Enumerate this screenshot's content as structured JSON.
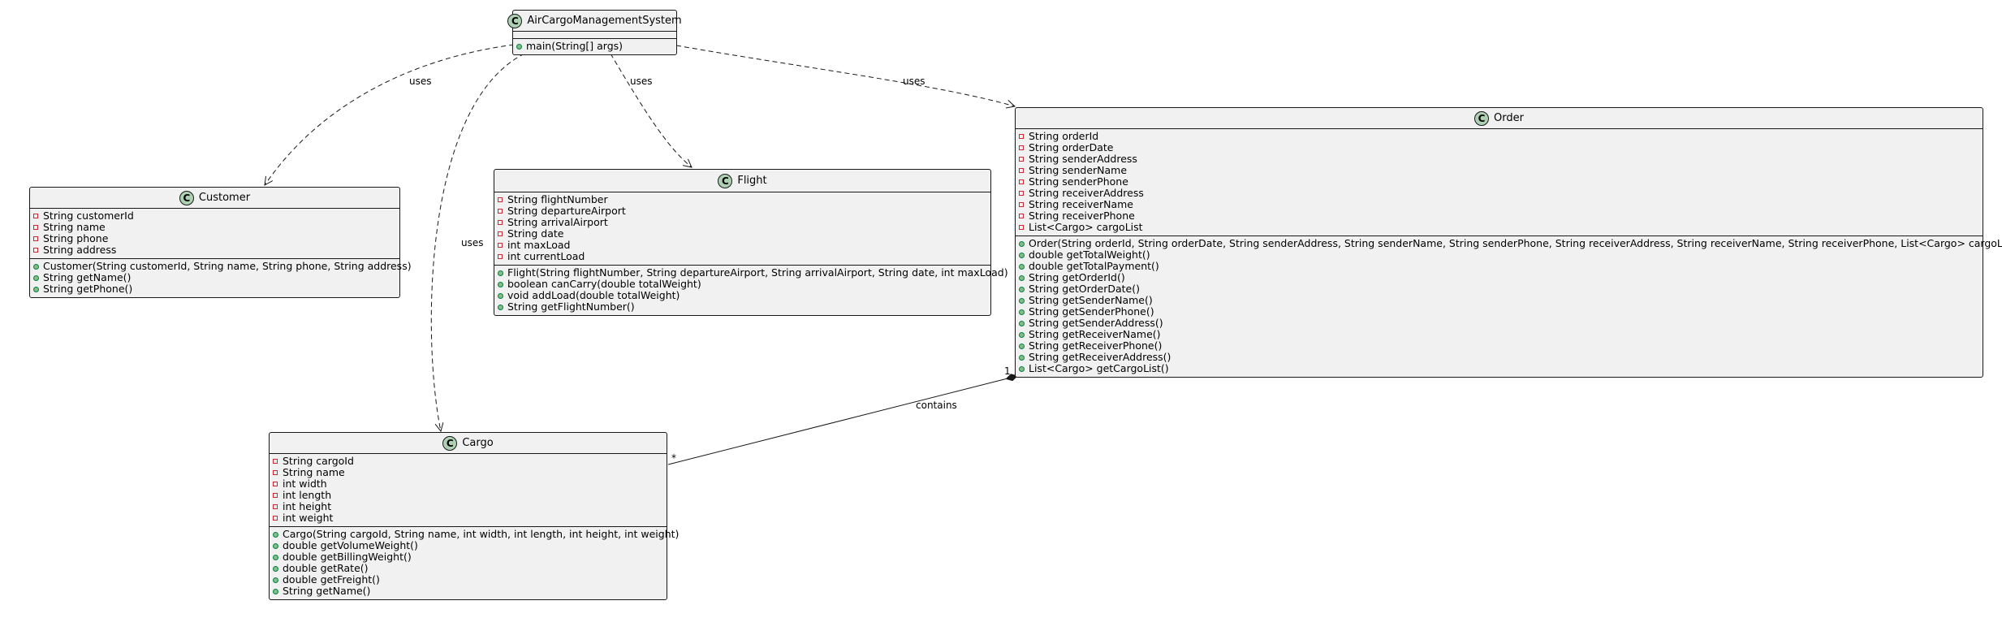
{
  "diagram": {
    "classes": [
      {
        "id": "acms",
        "badge": "C",
        "name": "AirCargoManagementSystem",
        "attributes": [],
        "methods": [
          {
            "vis": "public",
            "text": "main(String[] args)"
          }
        ]
      },
      {
        "id": "customer",
        "badge": "C",
        "name": "Customer",
        "attributes": [
          {
            "vis": "private",
            "text": "String customerId"
          },
          {
            "vis": "private",
            "text": "String name"
          },
          {
            "vis": "private",
            "text": "String phone"
          },
          {
            "vis": "private",
            "text": "String address"
          }
        ],
        "methods": [
          {
            "vis": "public",
            "text": "Customer(String customerId, String name, String phone, String address)"
          },
          {
            "vis": "public",
            "text": "String getName()"
          },
          {
            "vis": "public",
            "text": "String getPhone()"
          }
        ]
      },
      {
        "id": "flight",
        "badge": "C",
        "name": "Flight",
        "attributes": [
          {
            "vis": "private",
            "text": "String flightNumber"
          },
          {
            "vis": "private",
            "text": "String departureAirport"
          },
          {
            "vis": "private",
            "text": "String arrivalAirport"
          },
          {
            "vis": "private",
            "text": "String date"
          },
          {
            "vis": "private",
            "text": "int maxLoad"
          },
          {
            "vis": "private",
            "text": "int currentLoad"
          }
        ],
        "methods": [
          {
            "vis": "public",
            "text": "Flight(String flightNumber, String departureAirport, String arrivalAirport, String date, int maxLoad)"
          },
          {
            "vis": "public",
            "text": "boolean canCarry(double totalWeight)"
          },
          {
            "vis": "public",
            "text": "void addLoad(double totalWeight)"
          },
          {
            "vis": "public",
            "text": "String getFlightNumber()"
          }
        ]
      },
      {
        "id": "order",
        "badge": "C",
        "name": "Order",
        "attributes": [
          {
            "vis": "private",
            "text": "String orderId"
          },
          {
            "vis": "private",
            "text": "String orderDate"
          },
          {
            "vis": "private",
            "text": "String senderAddress"
          },
          {
            "vis": "private",
            "text": "String senderName"
          },
          {
            "vis": "private",
            "text": "String senderPhone"
          },
          {
            "vis": "private",
            "text": "String receiverAddress"
          },
          {
            "vis": "private",
            "text": "String receiverName"
          },
          {
            "vis": "private",
            "text": "String receiverPhone"
          },
          {
            "vis": "private",
            "text": "List<Cargo> cargoList"
          }
        ],
        "methods": [
          {
            "vis": "public",
            "text": "Order(String orderId, String orderDate, String senderAddress, String senderName, String senderPhone, String receiverAddress, String receiverName, String receiverPhone, List<Cargo> cargoList)"
          },
          {
            "vis": "public",
            "text": "double getTotalWeight()"
          },
          {
            "vis": "public",
            "text": "double getTotalPayment()"
          },
          {
            "vis": "public",
            "text": "String getOrderId()"
          },
          {
            "vis": "public",
            "text": "String getOrderDate()"
          },
          {
            "vis": "public",
            "text": "String getSenderName()"
          },
          {
            "vis": "public",
            "text": "String getSenderPhone()"
          },
          {
            "vis": "public",
            "text": "String getSenderAddress()"
          },
          {
            "vis": "public",
            "text": "String getReceiverName()"
          },
          {
            "vis": "public",
            "text": "String getReceiverPhone()"
          },
          {
            "vis": "public",
            "text": "String getReceiverAddress()"
          },
          {
            "vis": "public",
            "text": "List<Cargo> getCargoList()"
          }
        ]
      },
      {
        "id": "cargo",
        "badge": "C",
        "name": "Cargo",
        "attributes": [
          {
            "vis": "private",
            "text": "String cargoId"
          },
          {
            "vis": "private",
            "text": "String name"
          },
          {
            "vis": "private",
            "text": "int width"
          },
          {
            "vis": "private",
            "text": "int length"
          },
          {
            "vis": "private",
            "text": "int height"
          },
          {
            "vis": "private",
            "text": "int weight"
          }
        ],
        "methods": [
          {
            "vis": "public",
            "text": "Cargo(String cargoId, String name, int width, int length, int height, int weight)"
          },
          {
            "vis": "public",
            "text": "double getVolumeWeight()"
          },
          {
            "vis": "public",
            "text": "double getBillingWeight()"
          },
          {
            "vis": "public",
            "text": "double getRate()"
          },
          {
            "vis": "public",
            "text": "double getFreight()"
          },
          {
            "vis": "public",
            "text": "String getName()"
          }
        ]
      }
    ],
    "relations": [
      {
        "id": "acms-customer",
        "from": "AirCargoManagementSystem",
        "to": "Customer",
        "kind": "dependency",
        "label": "uses"
      },
      {
        "id": "acms-cargo",
        "from": "AirCargoManagementSystem",
        "to": "Cargo",
        "kind": "dependency",
        "label": "uses"
      },
      {
        "id": "acms-flight",
        "from": "AirCargoManagementSystem",
        "to": "Flight",
        "kind": "dependency",
        "label": "uses"
      },
      {
        "id": "acms-order",
        "from": "AirCargoManagementSystem",
        "to": "Order",
        "kind": "dependency",
        "label": "uses"
      },
      {
        "id": "order-cargo",
        "from": "Order",
        "to": "Cargo",
        "kind": "composition",
        "label": "contains",
        "from_multiplicity": "1",
        "to_multiplicity": "*"
      }
    ]
  }
}
